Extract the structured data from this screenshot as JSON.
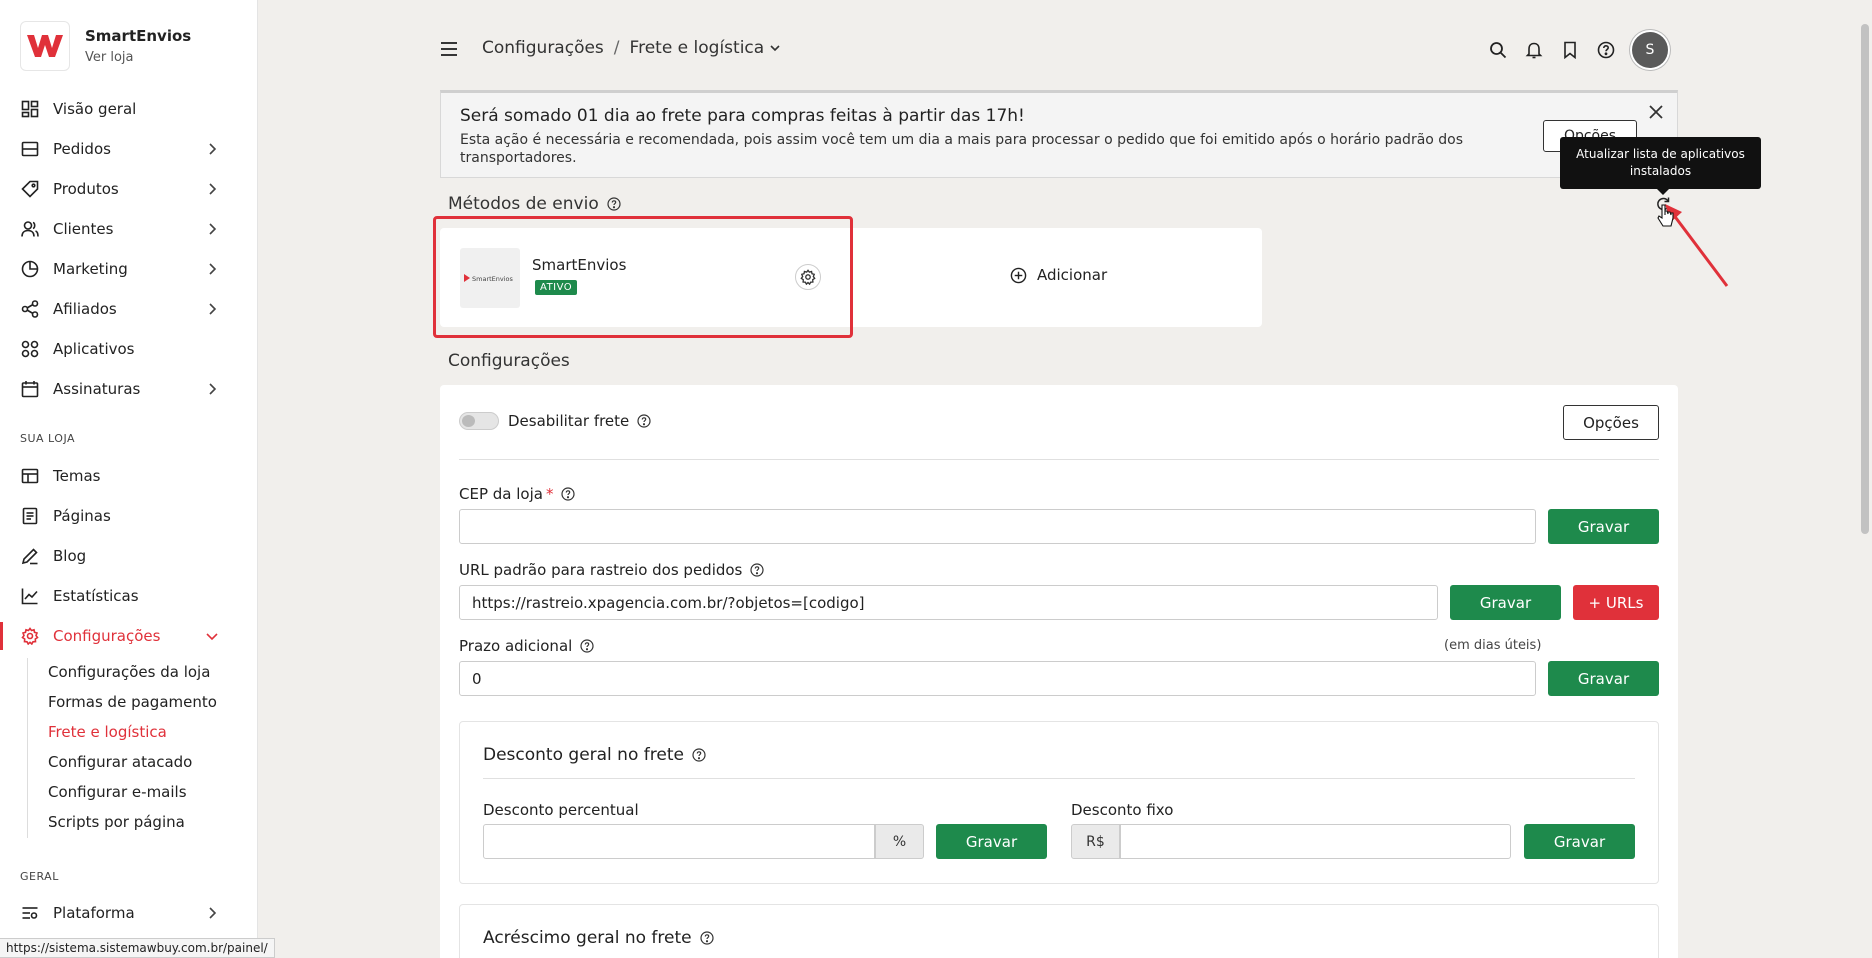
{
  "brand": {
    "name": "SmartEnvios",
    "sub": "Ver loja",
    "logo_letter": "W",
    "color": "#e0313a"
  },
  "nav": {
    "items": [
      {
        "label": "Visão geral"
      },
      {
        "label": "Pedidos"
      },
      {
        "label": "Produtos"
      },
      {
        "label": "Clientes"
      },
      {
        "label": "Marketing"
      },
      {
        "label": "Afiliados"
      },
      {
        "label": "Aplicativos"
      },
      {
        "label": "Assinaturas"
      }
    ],
    "section_store": "SUA LOJA",
    "store_items": [
      {
        "label": "Temas"
      },
      {
        "label": "Páginas"
      },
      {
        "label": "Blog"
      },
      {
        "label": "Estatísticas"
      },
      {
        "label": "Configurações"
      }
    ],
    "sub_items": [
      {
        "label": "Configurações da loja"
      },
      {
        "label": "Formas de pagamento"
      },
      {
        "label": "Frete e logística"
      },
      {
        "label": "Configurar atacado"
      },
      {
        "label": "Configurar e-mails"
      },
      {
        "label": "Scripts por página"
      }
    ],
    "section_general": "GERAL",
    "general_items": [
      {
        "label": "Plataforma"
      }
    ]
  },
  "status_url": "https://sistema.sistemawbuy.com.br/painel/",
  "header": {
    "crumb_root": "Configurações",
    "crumb_sep": "/",
    "crumb_current": "Frete e logística",
    "avatar_letter": "S"
  },
  "notice": {
    "title": "Será somado 01 dia ao frete para compras feitas à partir das 17h!",
    "body": "Esta ação é necessária e recomendada, pois assim você tem um dia a mais para processar o pedido que foi emitido após o horário padrão dos transportadores.",
    "button": "Opções"
  },
  "tooltip": "Atualizar lista de aplicativos instalados",
  "methods": {
    "title": "Métodos de envio",
    "logo_text": "SmartEnvios",
    "name": "SmartEnvios",
    "badge": "ATIVO",
    "add_label": "Adicionar"
  },
  "config": {
    "title": "Configurações",
    "disable_label": "Desabilitar frete",
    "options_button": "Opções",
    "cep_label": "CEP da loja",
    "cep_required": "*",
    "cep_value": "",
    "save": "Gravar",
    "tracking_label": "URL padrão para rastreio dos pedidos",
    "tracking_value": "https://rastreio.xpagencia.com.br/?objetos=[codigo]",
    "urls_button": "+ URLs",
    "extra_label": "Prazo adicional",
    "extra_hint": "(em dias úteis)",
    "extra_value": "0",
    "discount": {
      "title": "Desconto geral no frete",
      "percent_label": "Desconto percentual",
      "percent_addon": "%",
      "fixed_label": "Desconto fixo",
      "fixed_addon": "R$"
    },
    "increase_title": "Acréscimo geral no frete"
  }
}
